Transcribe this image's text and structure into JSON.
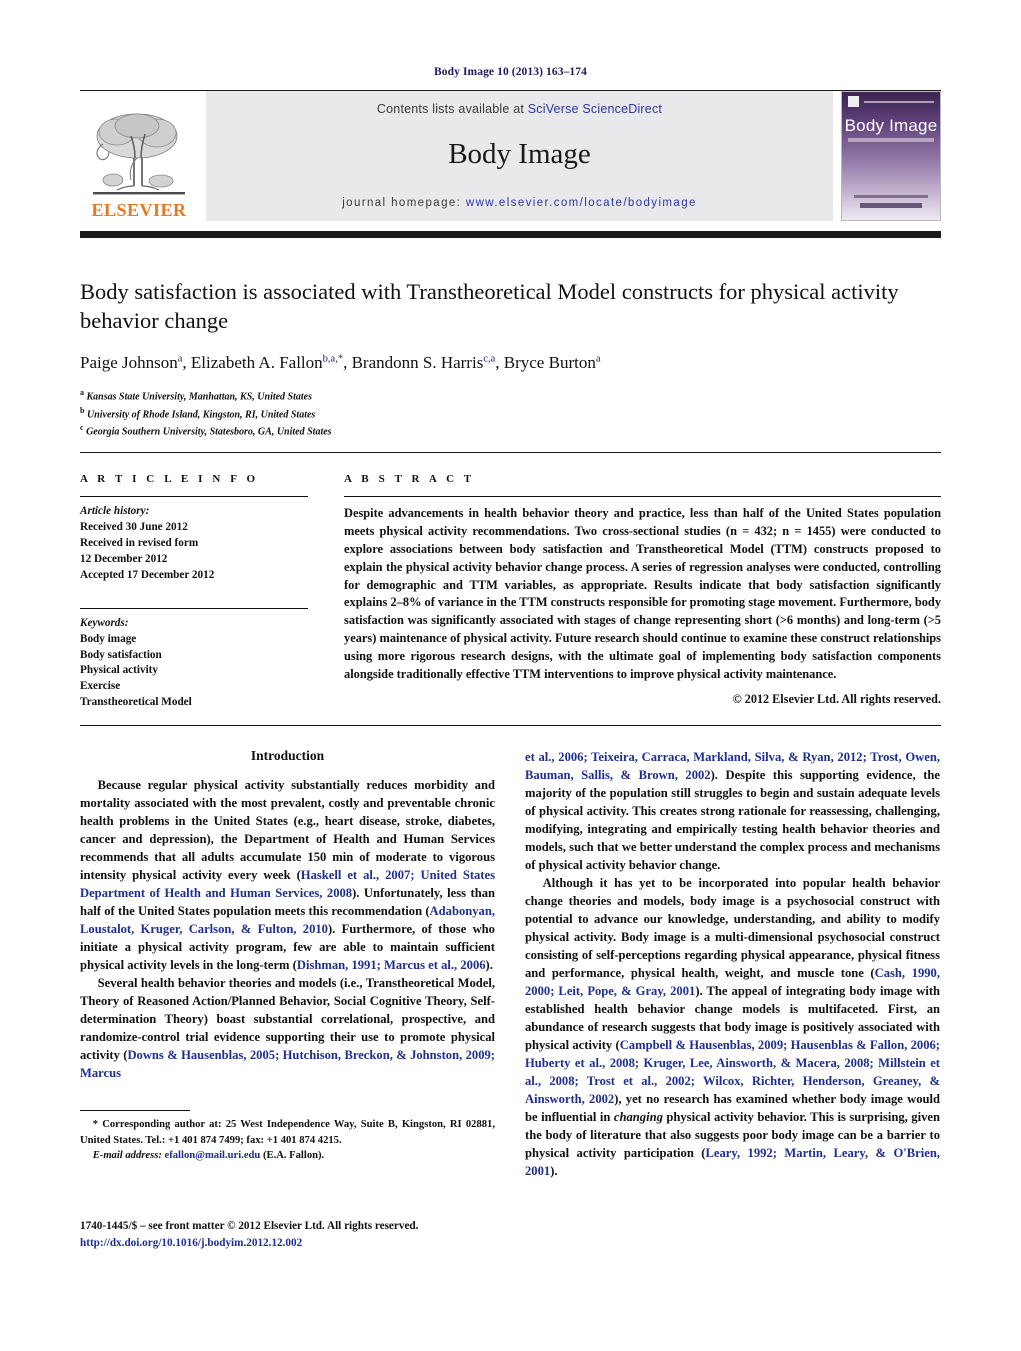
{
  "masthead": {
    "running_head": "Body Image 10 (2013) 163–174"
  },
  "header": {
    "publisher_logo_label": "ELSEVIER",
    "contents_prefix": "Contents lists available at ",
    "contents_link": "SciVerse ScienceDirect",
    "journal_name": "Body Image",
    "homepage_prefix": "journal homepage: ",
    "homepage_url": "www.elsevier.com/locate/bodyimage",
    "cover_title": "Body Image"
  },
  "article": {
    "title": "Body satisfaction is associated with Transtheoretical Model constructs for physical activity behavior change",
    "authors_html": "Paige Johnson<sup>a</sup>, Elizabeth A. Fallon<sup>b,a,</sup><sup>*</sup>, Brandonn S. Harris<sup>c,a</sup>, Bryce Burton<sup>a</sup>",
    "affiliations": [
      {
        "marker": "a",
        "text": "Kansas State University, Manhattan, KS, United States"
      },
      {
        "marker": "b",
        "text": "University of Rhode Island, Kingston, RI, United States"
      },
      {
        "marker": "c",
        "text": "Georgia Southern University, Statesboro, GA, United States"
      }
    ]
  },
  "article_info": {
    "heading": "A R T I C L E    I N F O",
    "history_label": "Article history:",
    "history_lines": [
      "Received 30 June 2012",
      "Received in revised form",
      "12 December 2012",
      "Accepted 17 December 2012"
    ],
    "keywords_label": "Keywords:",
    "keywords": [
      "Body image",
      "Body satisfaction",
      "Physical activity",
      "Exercise",
      "Transtheoretical Model"
    ]
  },
  "abstract": {
    "heading": "A B S T R A C T",
    "text": "Despite advancements in health behavior theory and practice, less than half of the United States population meets physical activity recommendations. Two cross-sectional studies (n = 432; n = 1455) were conducted to explore associations between body satisfaction and Transtheoretical Model (TTM) constructs proposed to explain the physical activity behavior change process. A series of regression analyses were conducted, controlling for demographic and TTM variables, as appropriate. Results indicate that body satisfaction significantly explains 2–8% of variance in the TTM constructs responsible for promoting stage movement. Furthermore, body satisfaction was significantly associated with stages of change representing short (>6 months) and long-term (>5 years) maintenance of physical activity. Future research should continue to examine these construct relationships using more rigorous research designs, with the ultimate goal of implementing body satisfaction components alongside traditionally effective TTM interventions to improve physical activity maintenance.",
    "copyright": "© 2012 Elsevier Ltd. All rights reserved."
  },
  "body": {
    "section_heading": "Introduction",
    "left_paragraphs": [
      {
        "runs": [
          {
            "t": "Because regular physical activity substantially reduces morbidity and mortality associated with the most prevalent, costly and preventable chronic health problems in the United States (e.g., heart disease, stroke, diabetes, cancer and depression), the Department of Health and Human Services recommends that all adults accumulate 150 min of moderate to vigorous intensity physical activity every week ("
          },
          {
            "t": "Haskell et al., 2007; United States Department of Health and Human Services, 2008",
            "cite": true
          },
          {
            "t": "). Unfortunately, less than half of the United States population meets this recommendation ("
          },
          {
            "t": "Adabonyan, Loustalot, Kruger, Carlson, & Fulton, 2010",
            "cite": true
          },
          {
            "t": "). Furthermore, of those who initiate a physical activity program, few are able to maintain sufficient physical activity levels in the long-term ("
          },
          {
            "t": "Dishman, 1991; Marcus et al., 2006",
            "cite": true
          },
          {
            "t": ")."
          }
        ]
      },
      {
        "runs": [
          {
            "t": "Several health behavior theories and models (i.e., Transtheoretical Model, Theory of Reasoned Action/Planned Behavior, Social Cognitive Theory, Self-determination Theory) boast substantial correlational, prospective, and randomize-control trial evidence supporting their use to promote physical activity ("
          },
          {
            "t": "Downs & Hausenblas, 2005; Hutchison, Breckon, & Johnston, 2009; Marcus",
            "cite": true
          }
        ]
      }
    ],
    "right_paragraphs": [
      {
        "runs": [
          {
            "t": "et al., 2006; Teixeira, Carraca, Markland, Silva, & Ryan, 2012; Trost, Owen, Bauman, Sallis, & Brown, 2002",
            "cite": true
          },
          {
            "t": "). Despite this supporting evidence, the majority of the population still struggles to begin and sustain adequate levels of physical activity. This creates strong rationale for reassessing, challenging, modifying, integrating and empirically testing health behavior theories and models, such that we better understand the complex process and mechanisms of physical activity behavior change."
          }
        ],
        "continuation": true
      },
      {
        "runs": [
          {
            "t": "Although it has yet to be incorporated into popular health behavior change theories and models, body image is a psychosocial construct with potential to advance our knowledge, understanding, and ability to modify physical activity. Body image is a multi-dimensional psychosocial construct consisting of self-perceptions regarding physical appearance, physical fitness and performance, physical health, weight, and muscle tone ("
          },
          {
            "t": "Cash, 1990, 2000; Leit, Pope, & Gray, 2001",
            "cite": true
          },
          {
            "t": "). The appeal of integrating body image with established health behavior change models is multifaceted. First, an abundance of research suggests that body image is positively associated with physical activity ("
          },
          {
            "t": "Campbell & Hausenblas, 2009; Hausenblas & Fallon, 2006; Huberty et al., 2008; Kruger, Lee, Ainsworth, & Macera, 2008; Millstein et al., 2008; Trost et al., 2002; Wilcox, Richter, Henderson, Greaney, & Ainsworth, 2002",
            "cite": true
          },
          {
            "t": "), yet no research has examined whether body image would be influential in "
          },
          {
            "t": "changing",
            "italic": true
          },
          {
            "t": " physical activity behavior. This is surprising, given the body of literature that also suggests poor body image can be a barrier to physical activity participation ("
          },
          {
            "t": "Leary, 1992; Martin, Leary, & O'Brien, 2001",
            "cite": true
          },
          {
            "t": ")."
          }
        ]
      }
    ]
  },
  "footnote": {
    "corresponding": "* Corresponding author at: 25 West Independence Way, Suite B, Kingston, RI 02881, United States. Tel.: +1 401 874 7499; fax: +1 401 874 4215.",
    "email_label": "E-mail address:",
    "email": "efallon@mail.uri.edu",
    "email_suffix": " (E.A. Fallon)."
  },
  "page_footer": {
    "issn_line": "1740-1445/$ – see front matter © 2012 Elsevier Ltd. All rights reserved.",
    "doi": "http://dx.doi.org/10.1016/j.bodyim.2012.12.002"
  },
  "colors": {
    "link_blue": "#1f2f8f",
    "elsevier_orange": "#E87722",
    "band_gray": "#e9e9ec"
  }
}
